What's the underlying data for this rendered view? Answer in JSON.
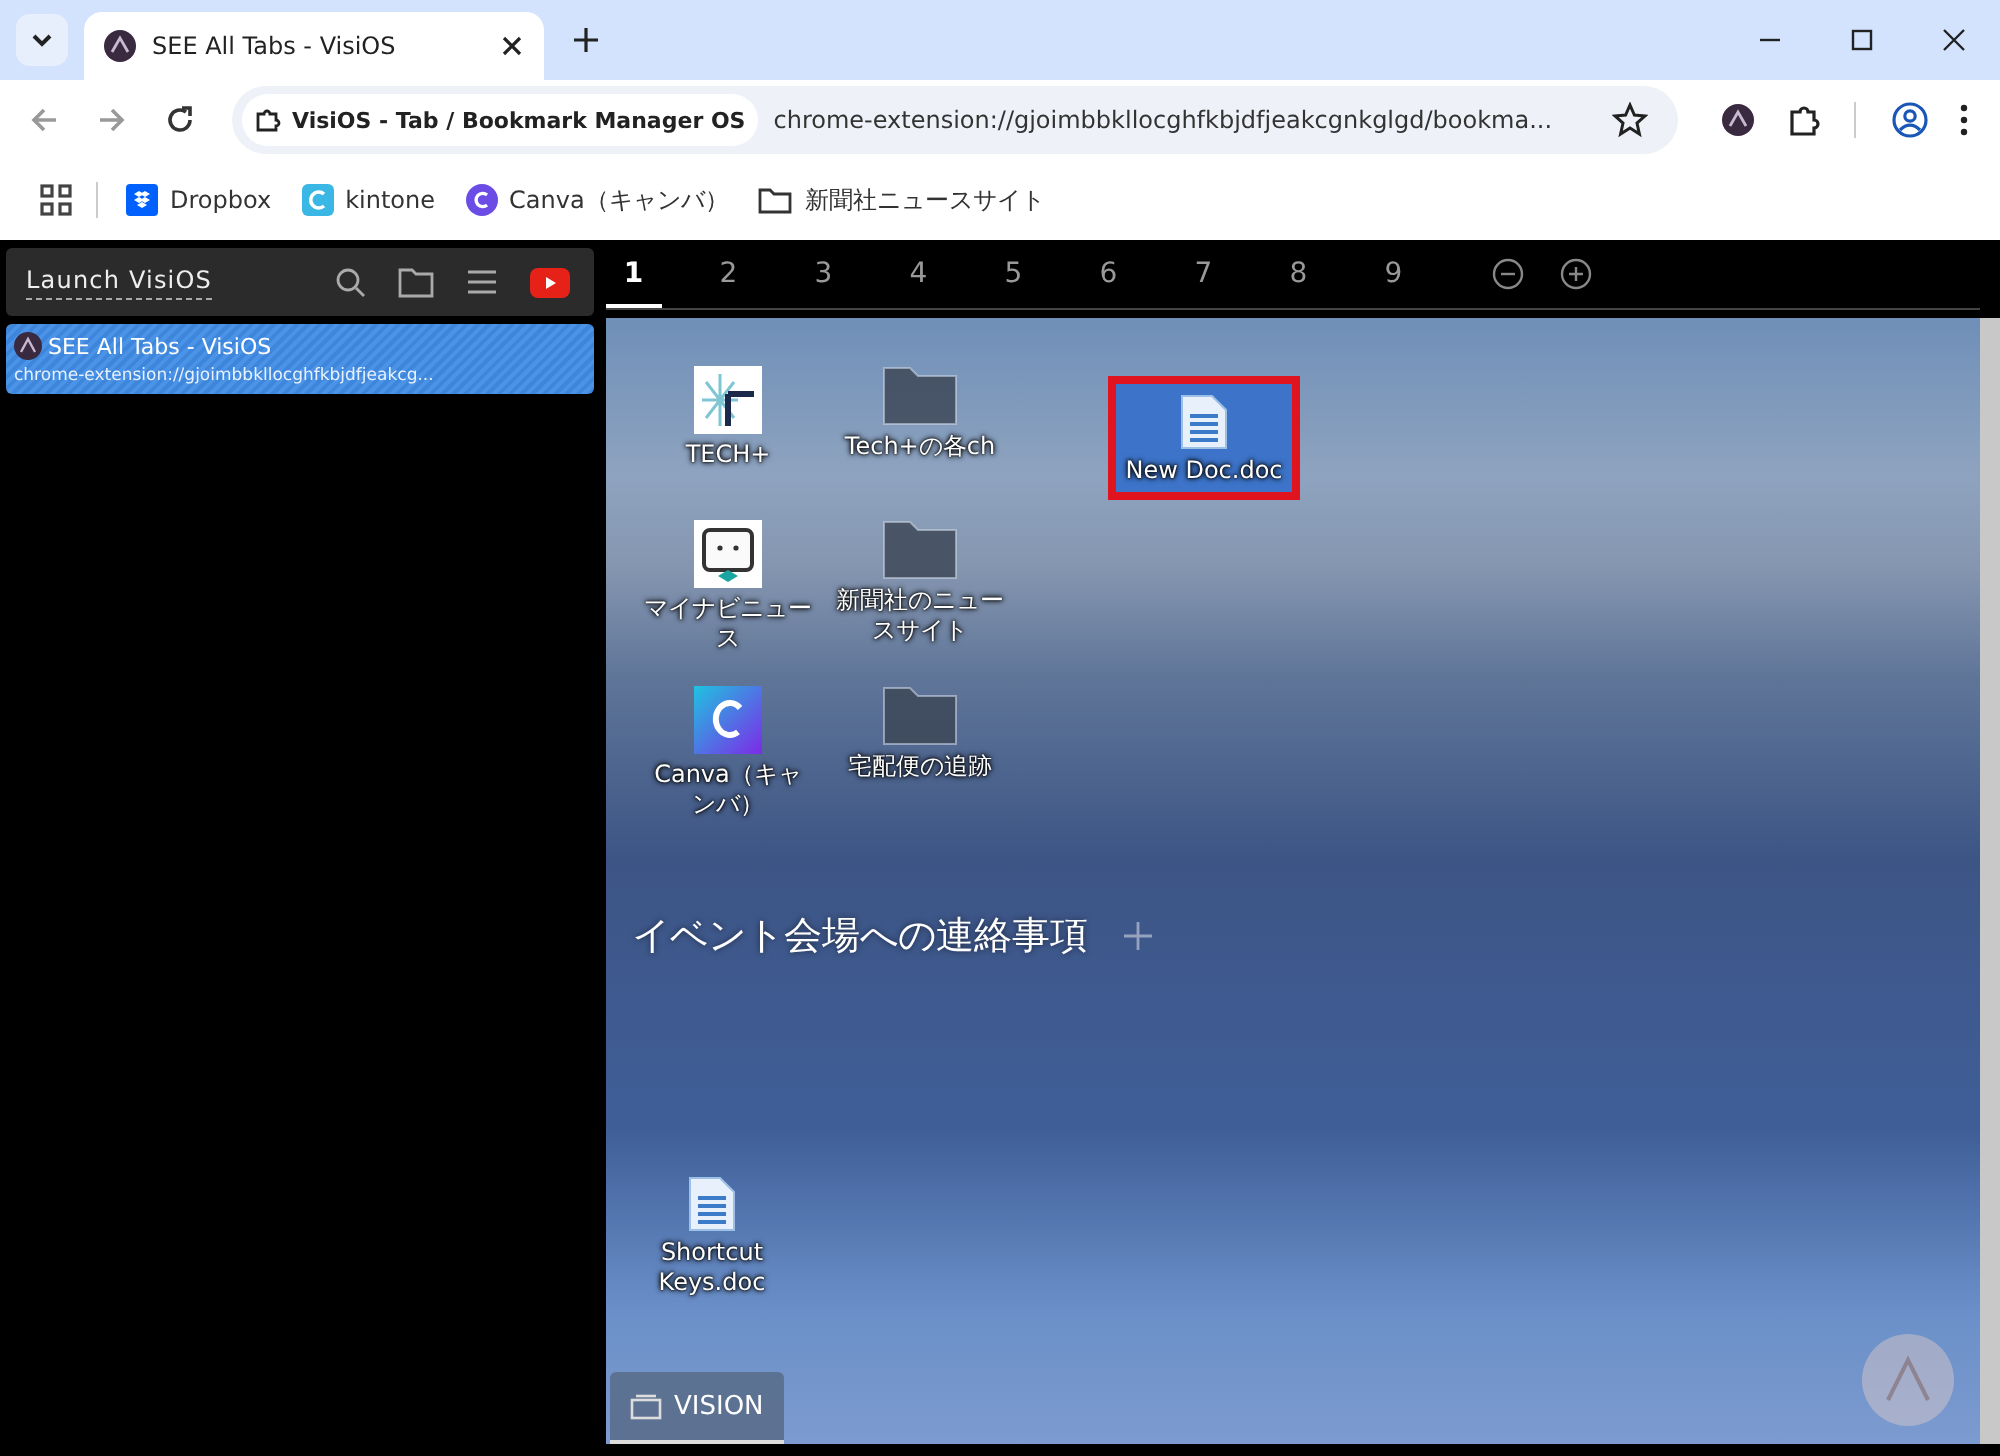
{
  "browser": {
    "tabs": [
      {
        "title": "SEE All Tabs - VisiOS",
        "selected": true
      }
    ],
    "address": {
      "site_chip": "VisiOS - Tab / Bookmark Manager OS",
      "url": "chrome-extension://gjoimbbkllocghfkbjdfjeakcgnkglgd/bookma..."
    },
    "bookmarks": [
      {
        "label": "Dropbox",
        "kind": "dropbox"
      },
      {
        "label": "kintone",
        "kind": "kintone"
      },
      {
        "label": "Canva（キャンバ）",
        "kind": "canva"
      },
      {
        "label": "新聞社ニュースサイト",
        "kind": "folder"
      }
    ]
  },
  "sidebar": {
    "launch_label": "Launch VisiOS",
    "tabs": [
      {
        "title": "SEE All Tabs - VisiOS",
        "url": "chrome-extension://gjoimbbkllocghfkbjdfjeakcg...",
        "selected": true
      }
    ]
  },
  "pages": [
    {
      "label": "1",
      "selected": true
    },
    {
      "label": "2",
      "selected": false
    },
    {
      "label": "3",
      "selected": false
    },
    {
      "label": "4",
      "selected": false
    },
    {
      "label": "5",
      "selected": false
    },
    {
      "label": "6",
      "selected": false
    },
    {
      "label": "7",
      "selected": false
    },
    {
      "label": "8",
      "selected": false
    },
    {
      "label": "9",
      "selected": false
    }
  ],
  "desktop": {
    "icons": [
      {
        "label": "TECH+",
        "kind": "tech",
        "selected": false
      },
      {
        "label": "Tech+の各ch",
        "kind": "folder",
        "selected": false
      },
      {
        "label": "マイナビニュース",
        "kind": "mascot",
        "selected": false
      },
      {
        "label": "新聞社のニュースサイト",
        "kind": "folder",
        "selected": false
      },
      {
        "label": "Canva（キャンバ）",
        "kind": "canva",
        "selected": false
      },
      {
        "label": "宅配便の追跡",
        "kind": "folder",
        "selected": false
      },
      {
        "label": "New Doc.doc",
        "kind": "doc",
        "selected": true
      },
      {
        "label": "Shortcut Keys.doc",
        "kind": "doc",
        "selected": false
      }
    ],
    "note_title": "イベント会場への連絡事項",
    "dock_label": "VISION"
  }
}
